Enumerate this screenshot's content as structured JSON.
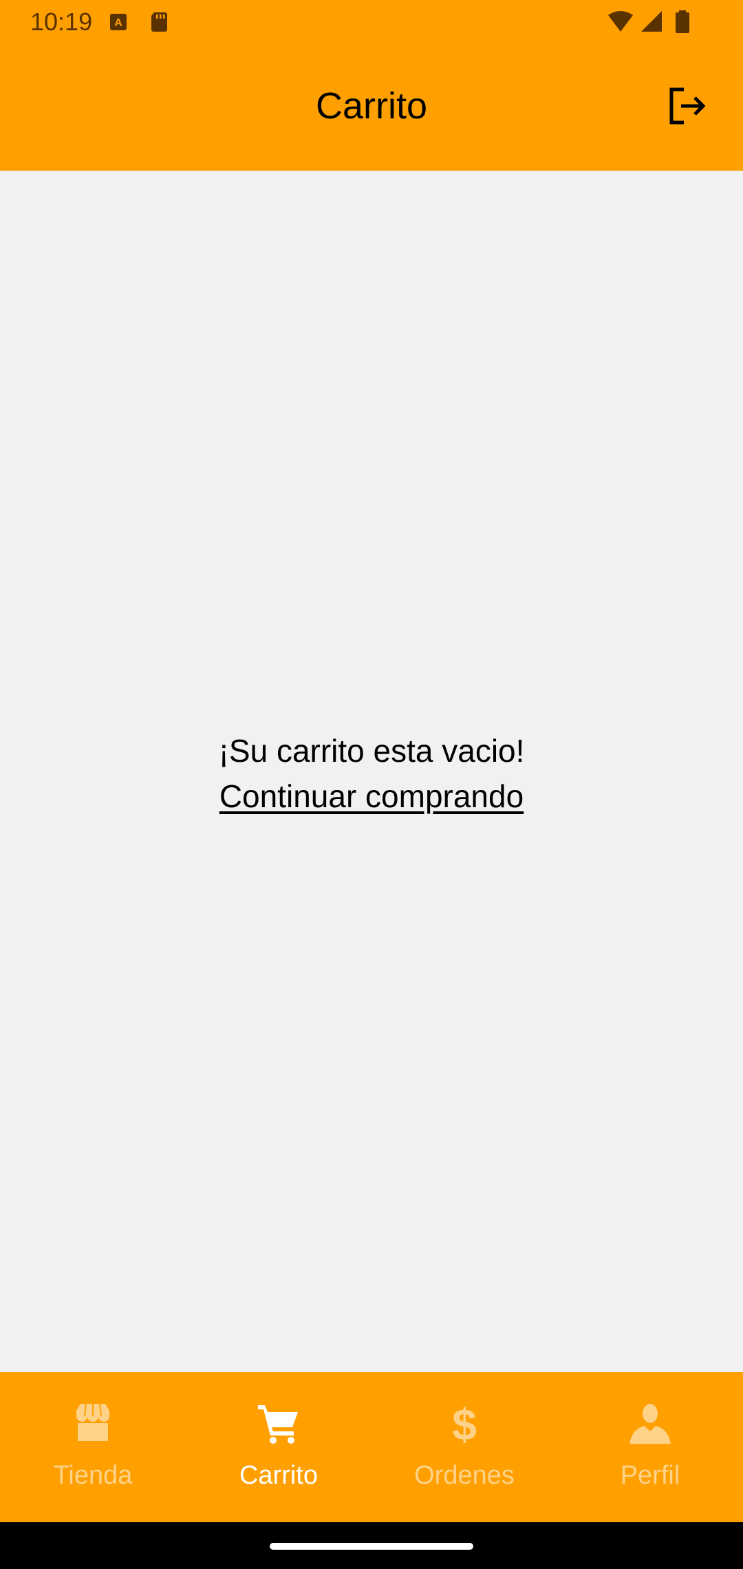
{
  "status_bar": {
    "time": "10:19",
    "icons": [
      "a-notification-icon",
      "sd-card-icon",
      "wifi-icon",
      "signal-icon",
      "battery-icon"
    ]
  },
  "header": {
    "title": "Carrito",
    "action_icon": "logout-icon"
  },
  "main": {
    "empty_message": "¡Su carrito esta vacio!",
    "continue_link": "Continuar comprando"
  },
  "bottom_nav": {
    "items": [
      {
        "label": "Tienda",
        "icon": "store-icon",
        "active": false
      },
      {
        "label": "Carrito",
        "icon": "cart-icon",
        "active": true
      },
      {
        "label": "Ordenes",
        "icon": "dollar-icon",
        "active": false
      },
      {
        "label": "Perfil",
        "icon": "person-icon",
        "active": false
      }
    ]
  },
  "colors": {
    "accent": "#ffa000",
    "background": "#f1f1f1",
    "nav_inactive": "#ffd28a",
    "nav_active": "#ffffff"
  }
}
